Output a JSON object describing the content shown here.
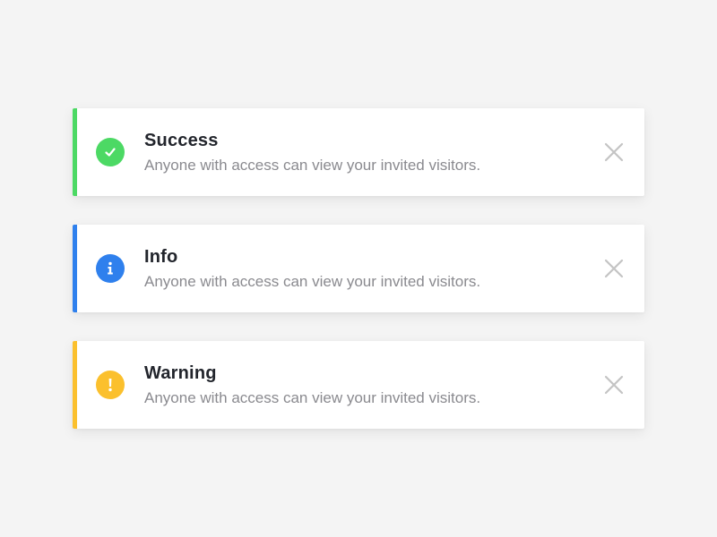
{
  "alerts": [
    {
      "type": "success",
      "title": "Success",
      "message": "Anyone with access can view your invited visitors.",
      "icon": "check-circle-icon",
      "color": "#4cd964"
    },
    {
      "type": "info",
      "title": "Info",
      "message": "Anyone with access can view your invited visitors.",
      "icon": "info-circle-icon",
      "color": "#2f80ed"
    },
    {
      "type": "warning",
      "title": "Warning",
      "message": "Anyone with access can view your invited visitors.",
      "icon": "warning-circle-icon",
      "color": "#fbc02d"
    }
  ],
  "close_icon": "close-icon",
  "close_color": "#c4c4c4",
  "background": "#f4f4f4"
}
